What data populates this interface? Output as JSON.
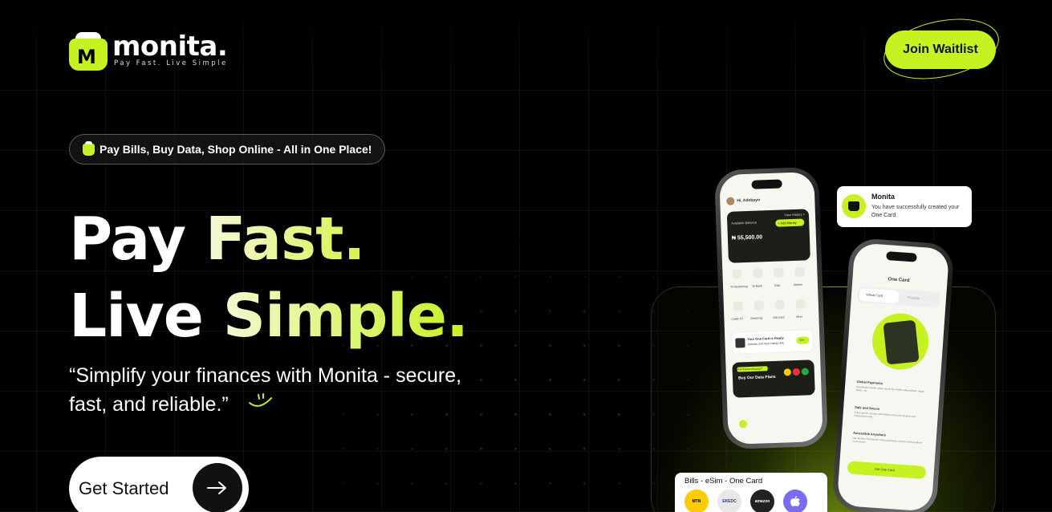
{
  "brand": {
    "name": "monita.",
    "tagline": "Pay Fast. Live Simple",
    "accent_color": "#c6f221"
  },
  "header": {
    "waitlist_label": "Join Waitlist"
  },
  "hero": {
    "pill_text": "Pay Bills, Buy Data, Shop Online - All in One Place!",
    "headline_line1_a": "Pay ",
    "headline_line1_b": "Fast.",
    "headline_line2_a": "Live ",
    "headline_line2_b": "Simple.",
    "subtitle_line1": "“Simplify your finances with Monita - secure,",
    "subtitle_line2": "fast, and reliable.”",
    "cta_label": "Get Started",
    "cta_icon": "arrow-right-icon"
  },
  "notification": {
    "title": "Monita",
    "message": "You have successfully created your One Card."
  },
  "phone1": {
    "greeting": "Hi, Adebayo",
    "balance_label": "Available Balance",
    "balance": "₦ 55,500.00",
    "add_money": "+ Add Money",
    "view_history": "View History >",
    "services": [
      "TV Monitoring",
      "To Bank",
      "Data",
      "Airtime",
      "Cable TV",
      "Electricity",
      "Gift Card",
      "More"
    ],
    "one_card_title": "Your One Card is Ready",
    "one_card_sub": "Activate and Start Using Now",
    "one_card_btn": "Get",
    "promo_badge": "For Internet Access?",
    "promo_text": "Buy Our Data Plans"
  },
  "phone2": {
    "title": "One Card",
    "tab_virtual": "Virtual Card",
    "tab_physical": "Physical",
    "features": [
      {
        "title": "Global Payments",
        "text": "Seamlessly handle online needs like Netflix subscriptions, Apple Music, etc."
      },
      {
        "title": "Safe and Secure",
        "text": "Enjoy top-tier security with Monita OneCard, keeping your transactions safe."
      },
      {
        "title": "Accessible Anywhere",
        "text": "Use Monita OneCard for online payments, anytime and anywhere in the world."
      }
    ],
    "button": "Get One Card"
  },
  "bills_card": {
    "title": "Bills - eSim - One Card",
    "providers": [
      "MTN",
      "EKEDC",
      "amazon",
      "apple"
    ]
  }
}
